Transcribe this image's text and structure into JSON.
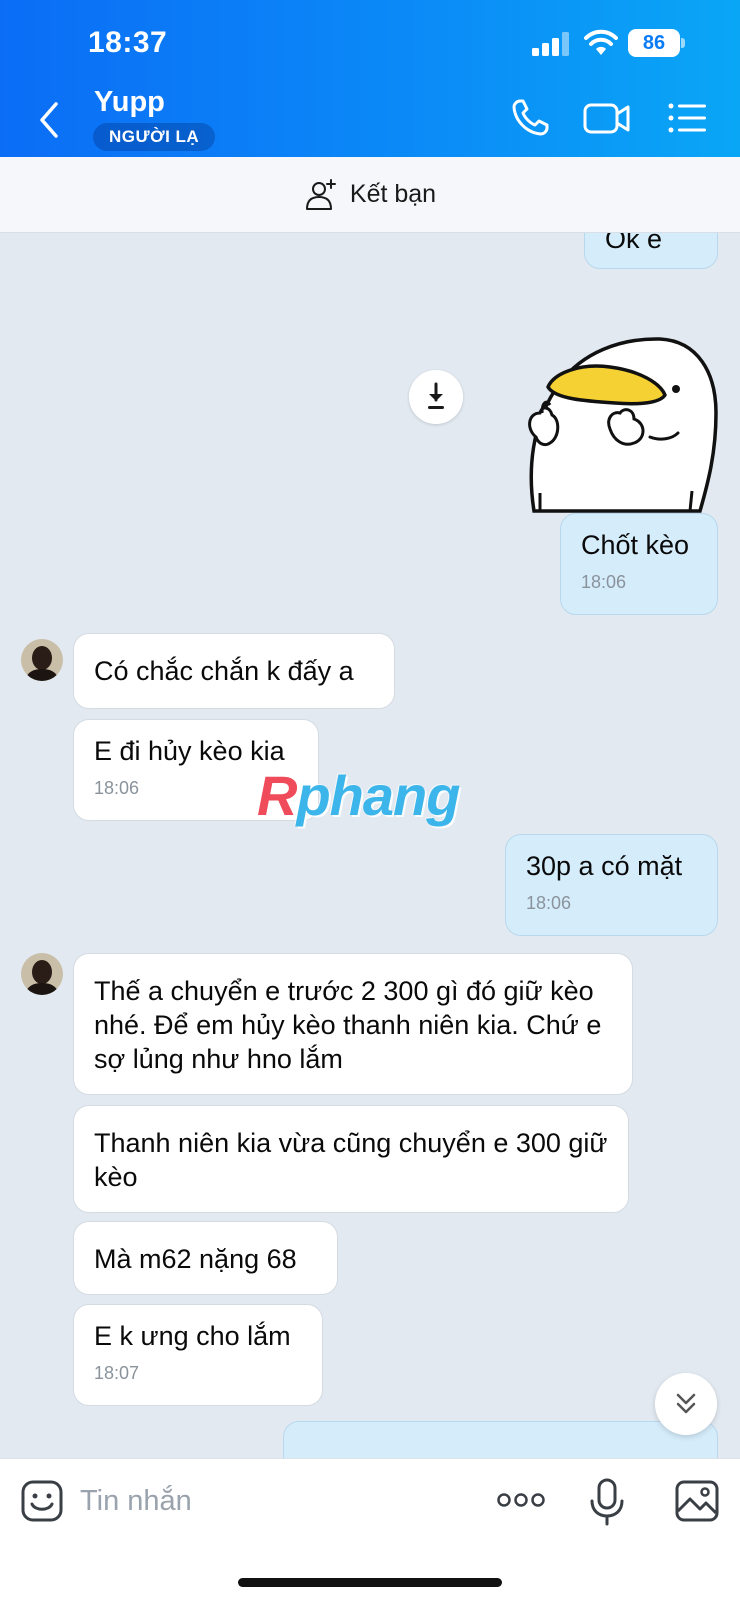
{
  "status_bar": {
    "time": "18:37",
    "battery": "86"
  },
  "header": {
    "contact_name": "Yupp",
    "badge": "NGƯỜI LẠ"
  },
  "friend_bar": {
    "label": "Kết bạn"
  },
  "messages": [
    {
      "side": "out",
      "text": "Ok e",
      "time": ""
    },
    {
      "side": "out",
      "text": "Chốt kèo",
      "time": "18:06"
    },
    {
      "side": "in",
      "text": "Có chắc chắn k đấy a",
      "time": ""
    },
    {
      "side": "in",
      "text": "E đi hủy kèo kia",
      "time": "18:06"
    },
    {
      "side": "out",
      "text": "30p a có mặt",
      "time": "18:06"
    },
    {
      "side": "in",
      "text": "Thế a chuyển e trước 2 300 gì đó giữ kèo nhé. Để em hủy kèo thanh niên kia. Chứ e sợ lủng như hno lắm",
      "time": ""
    },
    {
      "side": "in",
      "text": "Thanh niên kia vừa cũng chuyển e 300 giữ kèo",
      "time": ""
    },
    {
      "side": "in",
      "text": "Mà m62 nặng 68",
      "time": ""
    },
    {
      "side": "in",
      "text": "E k ưng cho lắm",
      "time": "18:07"
    }
  ],
  "watermark": {
    "first": "R",
    "rest": "phang"
  },
  "input": {
    "placeholder": "Tin nhắn"
  },
  "colors": {
    "header_blue": "#0b7cf7",
    "outgoing_bubble": "#d5ecfb",
    "incoming_bubble": "#ffffff",
    "chat_bg": "#e2e9f1"
  }
}
